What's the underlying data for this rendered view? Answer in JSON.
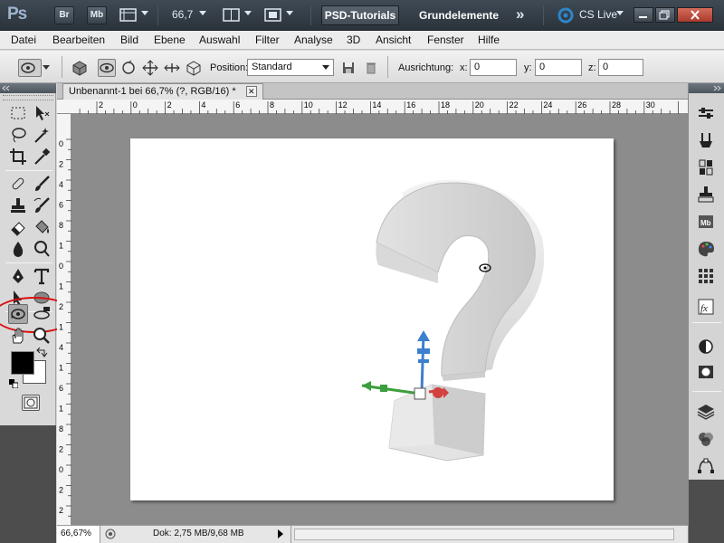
{
  "appbar": {
    "logo": "Ps",
    "bridge_label": "Br",
    "minibridge_label": "Mb",
    "zoom_value": "66,7",
    "workspace_active": "PSD-Tutorials",
    "workspace_name": "Grundelemente",
    "more_label": "»",
    "cs_live_label": "CS Live",
    "accent_color": "#2b86c9"
  },
  "menu": [
    "Datei",
    "Bearbeiten",
    "Bild",
    "Ebene",
    "Auswahl",
    "Filter",
    "Analyse",
    "3D",
    "Ansicht",
    "Fenster",
    "Hilfe"
  ],
  "options": {
    "position_label": "Position:",
    "position_value": "Standard",
    "orientation_label": "Ausrichtung:",
    "x_label": "x:",
    "x_value": "0",
    "y_label": "y:",
    "y_value": "0",
    "z_label": "z:",
    "z_value": "0"
  },
  "document": {
    "tab_title": "Unbenannt-1 bei 66,7% (?, RGB/16) *",
    "close_label": "✕",
    "ruler_top": [
      "2",
      "0",
      "2",
      "4",
      "6",
      "8",
      "10",
      "12",
      "14",
      "16",
      "18",
      "20",
      "22",
      "24",
      "26",
      "28",
      "30"
    ],
    "ruler_left": [
      "0",
      "2",
      "4",
      "6",
      "8",
      "1",
      "0",
      "1",
      "2",
      "1",
      "4",
      "1",
      "6",
      "1",
      "8",
      "2",
      "0",
      "2",
      "2"
    ]
  },
  "status": {
    "zoom": "66,67%",
    "doc_info": "Dok: 2,75 MB/9,68 MB"
  }
}
